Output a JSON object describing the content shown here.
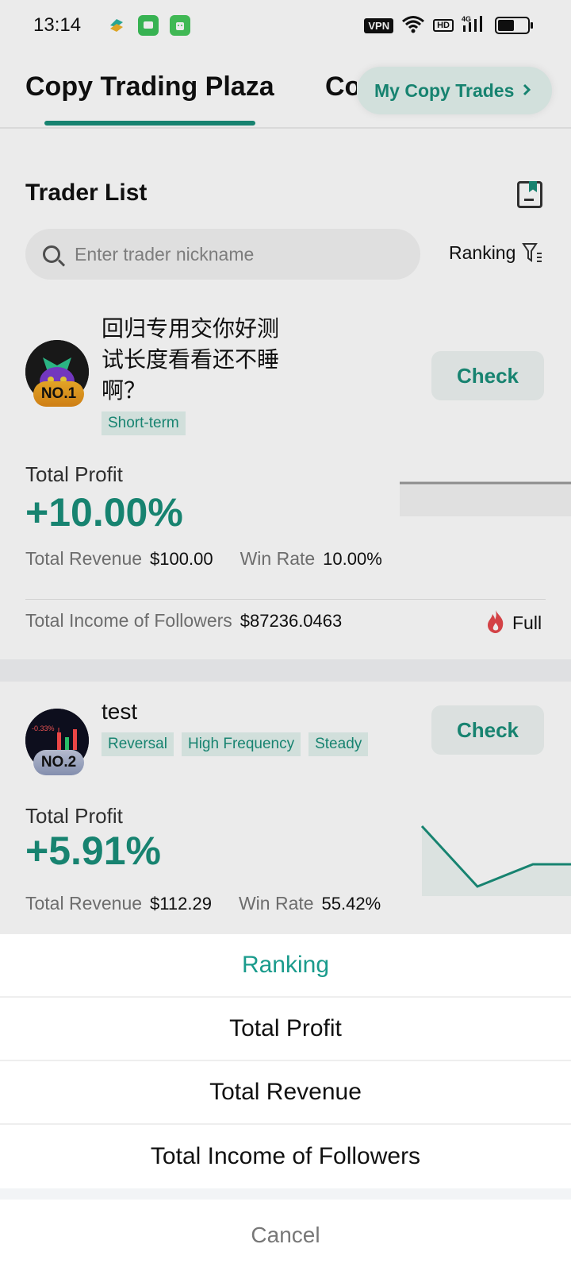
{
  "status_bar": {
    "time": "13:14",
    "vpn": "VPN",
    "hd": "HD",
    "network": "4G"
  },
  "header": {
    "tab_active": "Copy Trading Plaza",
    "tab_second": "Co",
    "my_copy_trades": "My Copy Trades",
    "accent_color": "#1a8f7a"
  },
  "trader_list": {
    "title": "Trader List",
    "search_placeholder": "Enter trader nickname",
    "ranking_label": "Ranking"
  },
  "traders": [
    {
      "rank": "NO.1",
      "name": "回归专用交你好测试长度看看还不睡啊？",
      "tags": [
        "Short-term"
      ],
      "check": "Check",
      "profit_label": "Total Profit",
      "profit_value": "+10.00%",
      "revenue_label": "Total Revenue",
      "revenue_value": "$100.00",
      "winrate_label": "Win Rate",
      "winrate_value": "10.00%",
      "income_label": "Total Income of Followers",
      "income_value": "$87236.0463",
      "status": "Full"
    },
    {
      "rank": "NO.2",
      "name": "test",
      "tags": [
        "Reversal",
        "High Frequency",
        "Steady"
      ],
      "check": "Check",
      "profit_label": "Total Profit",
      "profit_value": "+5.91%",
      "revenue_label": "Total Revenue",
      "revenue_value": "$112.29",
      "winrate_label": "Win Rate",
      "winrate_value": "55.42%"
    }
  ],
  "sheet": {
    "title": "Ranking",
    "options": [
      "Total Profit",
      "Total Revenue",
      "Total Income of Followers"
    ],
    "cancel": "Cancel"
  }
}
